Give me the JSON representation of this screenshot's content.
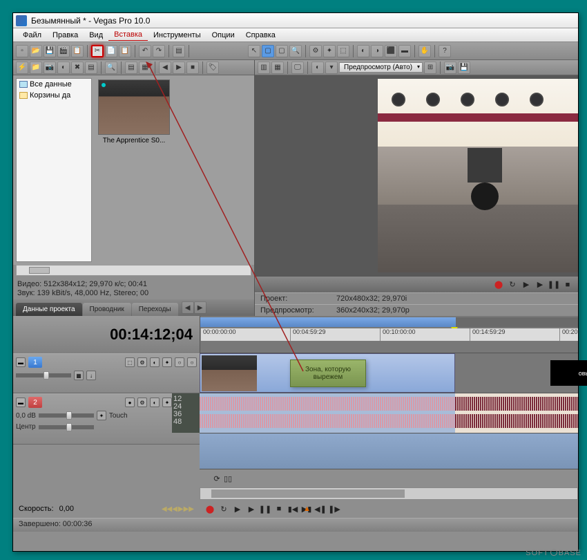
{
  "titlebar": {
    "text": "Безымянный * - Vegas Pro 10.0"
  },
  "menu": {
    "file": "Файл",
    "edit": "Правка",
    "view": "Вид",
    "insert": "Вставка",
    "tools": "Инструменты",
    "options": "Опции",
    "help": "Справка"
  },
  "project_browser": {
    "tree": {
      "all_data": "Все данные",
      "baskets": "Корзины да"
    },
    "thumbnail_label": "The Apprentice S0...",
    "info_video": "Видео: 512x384x12; 29,970 к/с; 00:41",
    "info_audio": "Звук: 139 kBit/s, 48,000 Hz, Stereo; 00",
    "tabs": {
      "project_data": "Данные проекта",
      "explorer": "Проводник",
      "transitions": "Переходы"
    }
  },
  "preview": {
    "dropdown": "Предпросмотр (Авто)",
    "project_label": "Проект:",
    "project_value": "720x480x32; 29,970i",
    "preview_label": "Предпросмотр:",
    "preview_value": "360x240x32; 29,970p"
  },
  "timecode": "00:14:12;04",
  "timeline": {
    "ticks": [
      "00:00:00:00",
      "00:04:59:29",
      "00:10:00:00",
      "00:14:59:29",
      "00:20"
    ],
    "cut_zone_text": "Зона, которую вырежем",
    "black_clip": "овы"
  },
  "tracks": {
    "video": {
      "num": "1"
    },
    "audio": {
      "num": "2",
      "gain": "0,0 dB",
      "touch": "Touch",
      "center": "Центр",
      "meter_levels": [
        "12",
        "24",
        "36",
        "48"
      ]
    }
  },
  "speed": {
    "label": "Скорость:",
    "value": "0,00"
  },
  "status": {
    "label": "Завершено:",
    "value": "00:00:36"
  },
  "watermark": {
    "left": "SOFT",
    "right": "BASE"
  }
}
